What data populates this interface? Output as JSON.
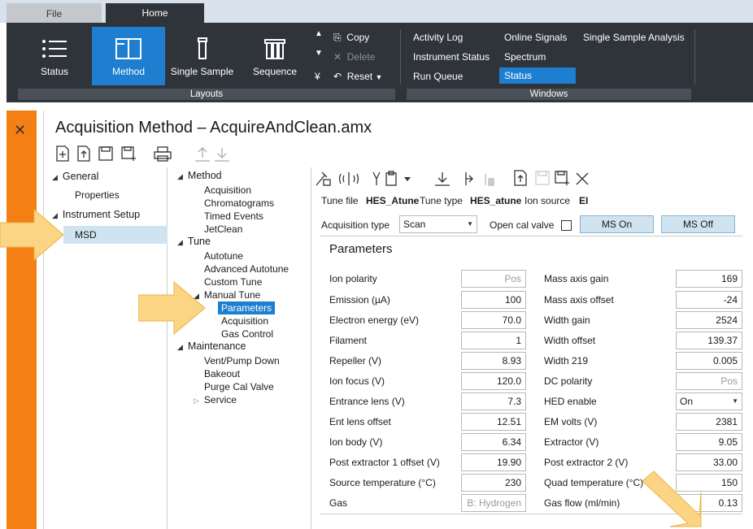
{
  "tabs": {
    "file": "File",
    "home": "Home"
  },
  "ribbon": {
    "status": "Status",
    "method": "Method",
    "single_sample": "Single Sample",
    "sequence": "Sequence",
    "copy": "Copy",
    "delete": "Delete",
    "reset": "Reset",
    "layouts": "Layouts",
    "activity_log": "Activity Log",
    "instrument_status": "Instrument Status",
    "run_queue": "Run Queue",
    "online_signals": "Online Signals",
    "spectrum": "Spectrum",
    "status_window": "Status",
    "single_sample_analysis": "Single Sample Analysis",
    "windows": "Windows"
  },
  "page_title": "Acquisition Method – AcquireAndClean.amx",
  "tree1": {
    "general": "General",
    "properties": "Properties",
    "instrument_setup": "Instrument Setup",
    "msd": "MSD"
  },
  "tree2": {
    "method": "Method",
    "acquisition": "Acquisition",
    "chromatograms": "Chromatograms",
    "timed_events": "Timed Events",
    "jetclean": "JetClean",
    "tune": "Tune",
    "autotune": "Autotune",
    "advanced_autotune": "Advanced Autotune",
    "custom_tune": "Custom Tune",
    "manual_tune": "Manual Tune",
    "parameters": "Parameters",
    "mt_acquisition": "Acquisition",
    "gas_control": "Gas Control",
    "maintenance": "Maintenance",
    "vent_pump": "Vent/Pump Down",
    "bakeout": "Bakeout",
    "purge_cal": "Purge Cal Valve",
    "service": "Service"
  },
  "tune_info": {
    "tune_file_label": "Tune file",
    "tune_file": "HES_Atune",
    "tune_type_label": "Tune type",
    "tune_type": "HES_atune",
    "ion_source_label": "Ion source",
    "ion_source": "EI"
  },
  "acq": {
    "type_label": "Acquisition type",
    "type_value": "Scan",
    "open_cal_label": "Open cal valve",
    "ms_on": "MS On",
    "ms_off": "MS Off"
  },
  "params_title": "Parameters",
  "left_params": [
    {
      "label": "Ion polarity",
      "value": "Pos"
    },
    {
      "label": "Emission (µA)",
      "value": "100"
    },
    {
      "label": "Electron energy (eV)",
      "value": "70.0"
    },
    {
      "label": "Filament",
      "value": "1"
    },
    {
      "label": "Repeller (V)",
      "value": "8.93"
    },
    {
      "label": "Ion focus (V)",
      "value": "120.0"
    },
    {
      "label": "Entrance lens (V)",
      "value": "7.3"
    },
    {
      "label": "Ent lens offset",
      "value": "12.51"
    },
    {
      "label": "Ion body (V)",
      "value": "6.34"
    },
    {
      "label": "Post extractor 1 offset (V)",
      "value": "19.90"
    },
    {
      "label": "Source temperature (°C)",
      "value": "230"
    },
    {
      "label": "Gas",
      "value": "B: Hydrogen"
    }
  ],
  "right_params": [
    {
      "label": "Mass axis gain",
      "value": "169"
    },
    {
      "label": "Mass axis offset",
      "value": "-24"
    },
    {
      "label": "Width gain",
      "value": "2524"
    },
    {
      "label": "Width offset",
      "value": "139.37"
    },
    {
      "label": "Width 219",
      "value": "0.005"
    },
    {
      "label": "DC polarity",
      "value": "Pos"
    },
    {
      "label": "HED enable",
      "value": "On"
    },
    {
      "label": "EM volts (V)",
      "value": "2381"
    },
    {
      "label": "Extractor (V)",
      "value": "9.05"
    },
    {
      "label": "Post extractor 2 (V)",
      "value": "33.00"
    },
    {
      "label": "Quad temperature (°C)",
      "value": "150"
    },
    {
      "label": "Gas flow (ml/min)",
      "value": "0.13"
    }
  ],
  "colors": {
    "orange": "#f47f14",
    "ribbon": "#2f343a",
    "accent": "#1e7fd1",
    "arrow": "#fbd583"
  }
}
